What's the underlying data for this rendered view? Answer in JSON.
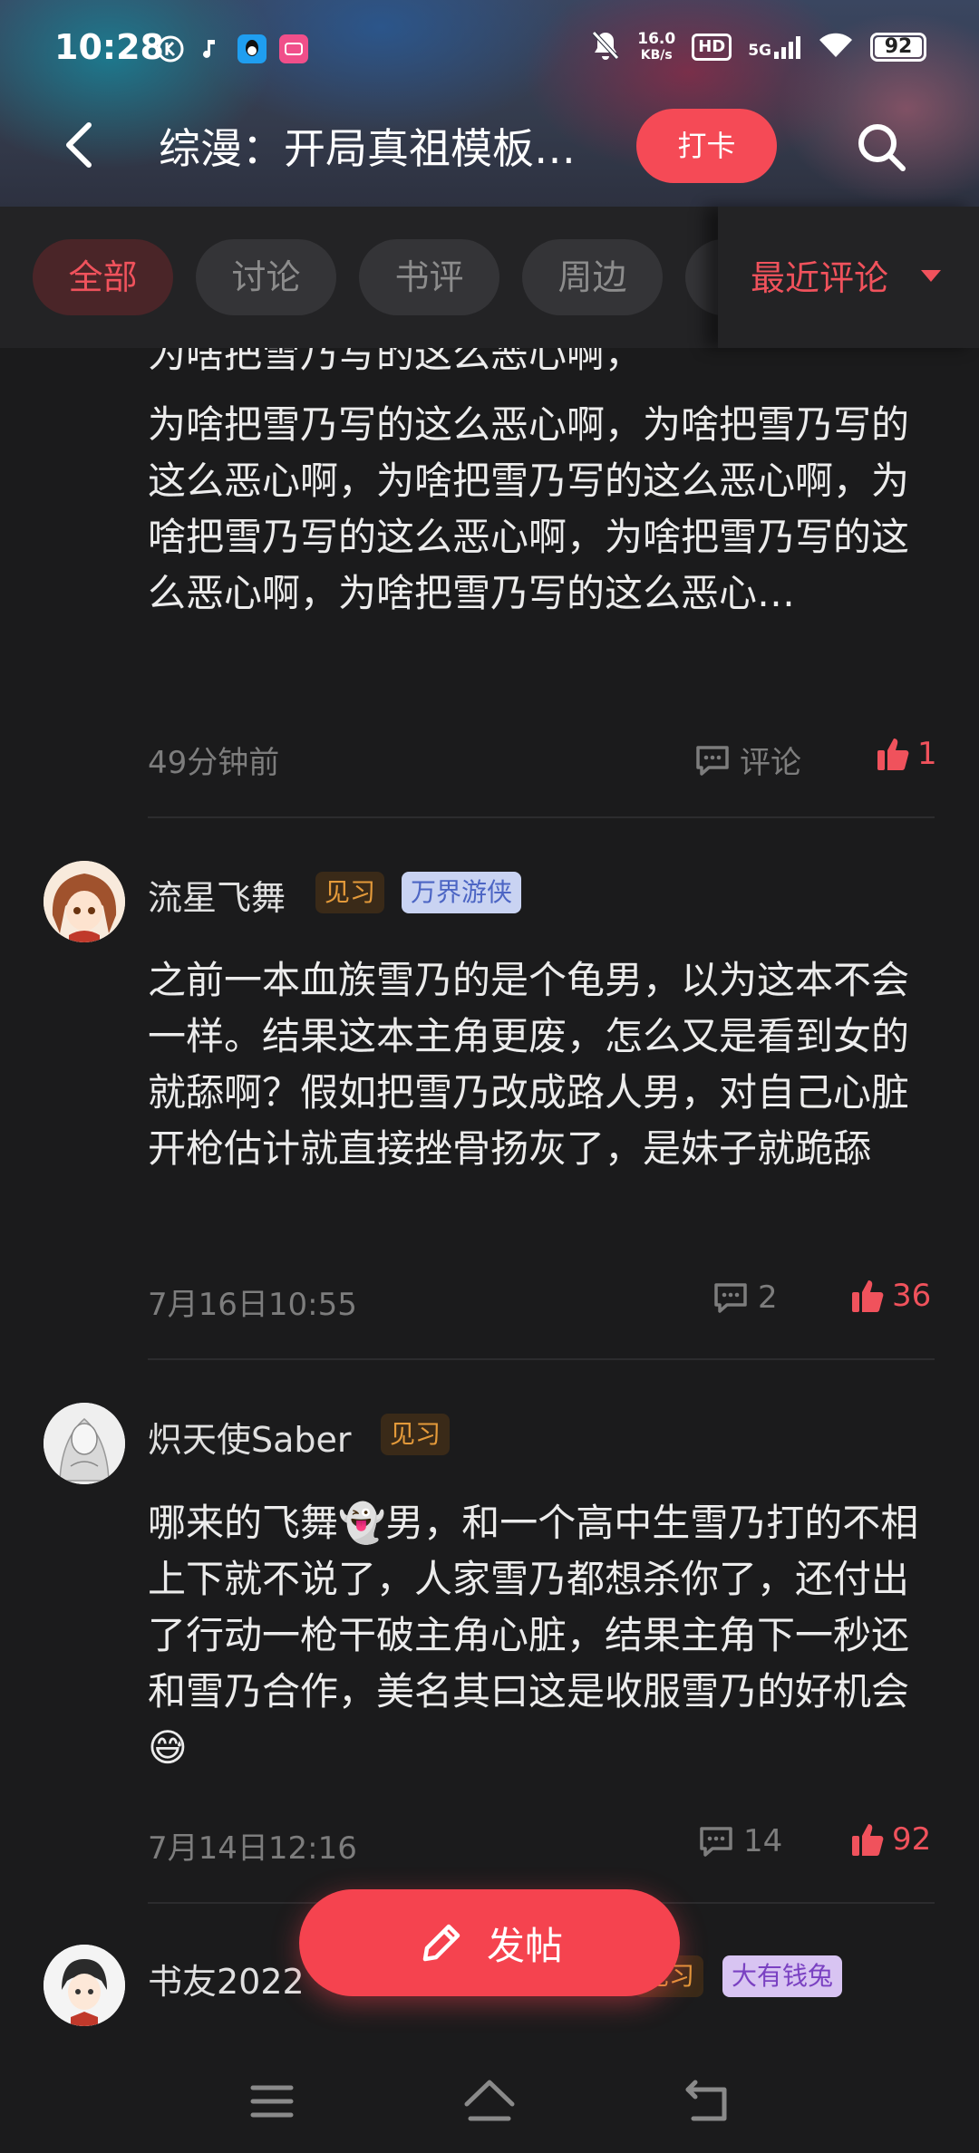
{
  "status_bar": {
    "time": "10:28",
    "net_speed_value": "16.0",
    "net_speed_unit": "KB/s",
    "hd_label": "HD",
    "signal_label": "5G",
    "battery": "92"
  },
  "header": {
    "title": "综漫：开局真祖模板…",
    "checkin_label": "打卡"
  },
  "filters": {
    "chips": [
      "全部",
      "讨论",
      "书评",
      "周边"
    ],
    "active_index": 0,
    "sort_label": "最近评论"
  },
  "posts": [
    {
      "partial_line": "为啥把雪乃写的这么恶心啊，",
      "text": "为啥把雪乃写的这么恶心啊，为啥把雪乃写的这么恶心啊，为啥把雪乃写的这么恶心啊，为啥把雪乃写的这么恶心啊，为啥把雪乃写的这么恶心啊，为啥把雪乃写的这么恶心…",
      "time": "49分钟前",
      "comment_label": "评论",
      "likes": "1"
    },
    {
      "username": "流星飞舞",
      "level_badge": "见习",
      "title_badge": "万界游侠",
      "text": "之前一本血族雪乃的是个龟男，以为这本不会一样。结果这本主角更废，怎么又是看到女的就舔啊？假如把雪乃改成路人男，对自己心脏开枪估计就直接挫骨扬灰了，是妹子就跪舔",
      "time": "7月16日10:55",
      "comments": "2",
      "likes": "36"
    },
    {
      "username": "炽天使Saber",
      "level_badge": "见习",
      "text": "哪来的飞舞👻男，和一个高中生雪乃打的不相上下就不说了，人家雪乃都想杀你了，还付出了行动一枪干破主角心脏，结果主角下一秒还和雪乃合作，美名其曰这是收服雪乃的好机会😅",
      "time": "7月14日12:16",
      "comments": "14",
      "likes": "92"
    },
    {
      "username": "书友2022",
      "level_badge": "见习",
      "title_badge": "大有钱兔"
    }
  ],
  "post_button_label": "发帖",
  "colors": {
    "accent": "#f54a56",
    "background": "#1b1b1c",
    "muted": "#7d7d7d"
  },
  "icons": [
    "back-arrow-icon",
    "search-icon",
    "comment-icon",
    "thumbs-up-icon",
    "pencil-icon",
    "menu-icon",
    "home-icon",
    "back-nav-icon"
  ]
}
